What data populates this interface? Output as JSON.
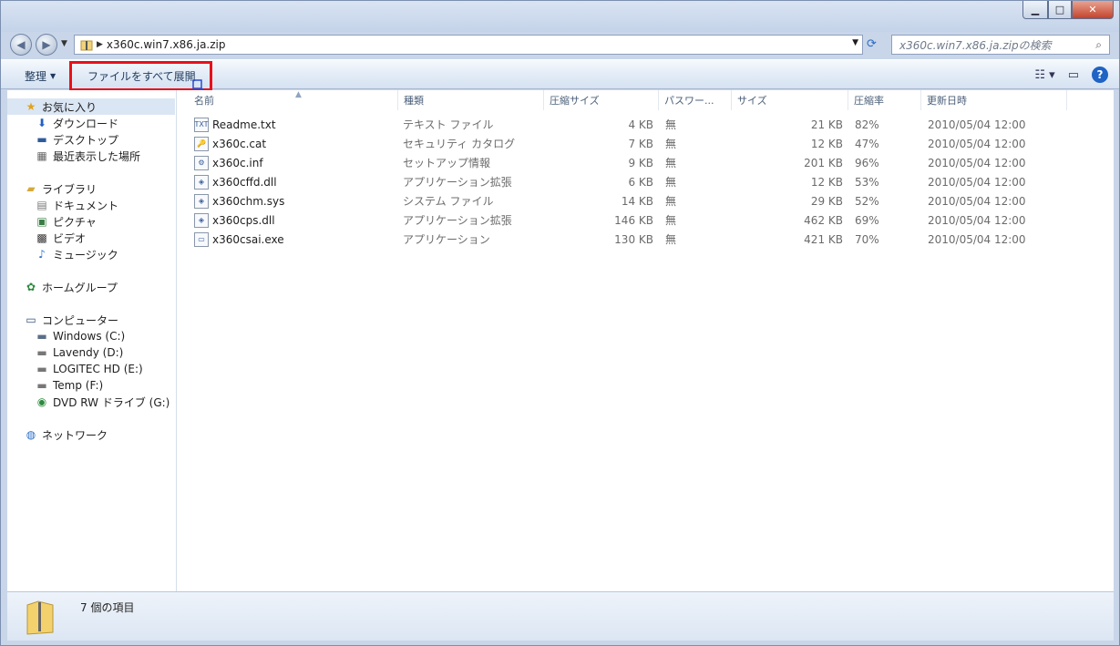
{
  "window": {
    "minimize_glyph": "▁",
    "maximize_glyph": "□",
    "close_glyph": "✕"
  },
  "address": {
    "path": "x360c.win7.x86.ja.zip",
    "search_placeholder": "x360c.win7.x86.ja.zipの検索"
  },
  "toolbar": {
    "organize_label": "整理",
    "extract_all_label": "ファイルをすべて展開"
  },
  "nav": {
    "favorites": {
      "label": "お気に入り",
      "items": [
        "ダウンロード",
        "デスクトップ",
        "最近表示した場所"
      ]
    },
    "libraries": {
      "label": "ライブラリ",
      "items": [
        "ドキュメント",
        "ピクチャ",
        "ビデオ",
        "ミュージック"
      ]
    },
    "homegroup": {
      "label": "ホームグループ"
    },
    "computer": {
      "label": "コンピューター",
      "items": [
        "Windows (C:)",
        "Lavendy (D:)",
        "LOGITEC HD (E:)",
        "Temp (F:)",
        "DVD RW ドライブ (G:)"
      ]
    },
    "network": {
      "label": "ネットワーク"
    }
  },
  "columns": [
    "名前",
    "種類",
    "圧縮サイズ",
    "パスワー...",
    "サイズ",
    "圧縮率",
    "更新日時"
  ],
  "files": [
    {
      "name": "Readme.txt",
      "type": "テキスト ファイル",
      "packed": "4 KB",
      "password": "無",
      "size": "21 KB",
      "ratio": "82%",
      "date": "2010/05/04 12:00",
      "icon": "text-file-icon"
    },
    {
      "name": "x360c.cat",
      "type": "セキュリティ カタログ",
      "packed": "7 KB",
      "password": "無",
      "size": "12 KB",
      "ratio": "47%",
      "date": "2010/05/04 12:00",
      "icon": "catalog-file-icon"
    },
    {
      "name": "x360c.inf",
      "type": "セットアップ情報",
      "packed": "9 KB",
      "password": "無",
      "size": "201 KB",
      "ratio": "96%",
      "date": "2010/05/04 12:00",
      "icon": "setup-info-icon"
    },
    {
      "name": "x360cffd.dll",
      "type": "アプリケーション拡張",
      "packed": "6 KB",
      "password": "無",
      "size": "12 KB",
      "ratio": "53%",
      "date": "2010/05/04 12:00",
      "icon": "dll-file-icon"
    },
    {
      "name": "x360chm.sys",
      "type": "システム ファイル",
      "packed": "14 KB",
      "password": "無",
      "size": "29 KB",
      "ratio": "52%",
      "date": "2010/05/04 12:00",
      "icon": "system-file-icon"
    },
    {
      "name": "x360cps.dll",
      "type": "アプリケーション拡張",
      "packed": "146 KB",
      "password": "無",
      "size": "462 KB",
      "ratio": "69%",
      "date": "2010/05/04 12:00",
      "icon": "dll-file-icon"
    },
    {
      "name": "x360csai.exe",
      "type": "アプリケーション",
      "packed": "130 KB",
      "password": "無",
      "size": "421 KB",
      "ratio": "70%",
      "date": "2010/05/04 12:00",
      "icon": "exe-file-icon"
    }
  ],
  "status": {
    "text": "7 個の項目"
  },
  "colors": {
    "highlight": "#e8101a",
    "toolbar_text": "#1e395b",
    "column_header": "#4c607a"
  }
}
